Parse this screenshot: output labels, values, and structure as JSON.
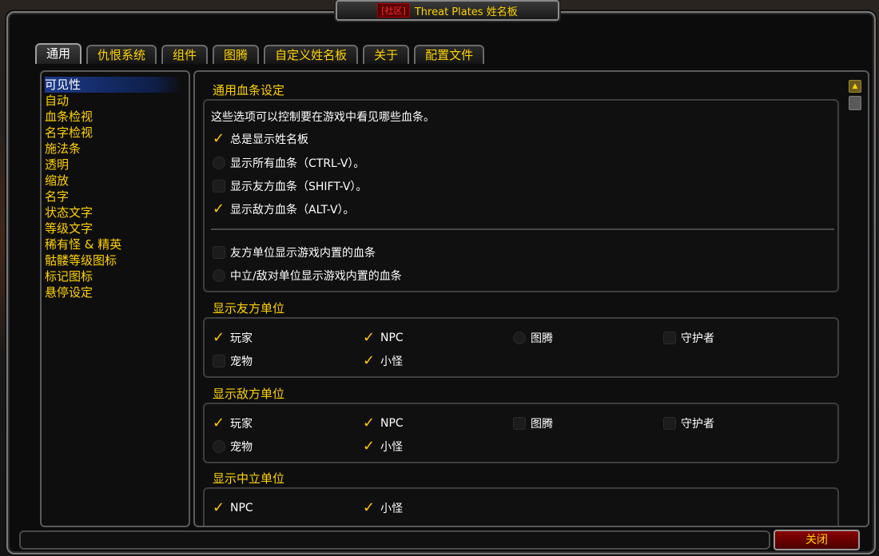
{
  "window": {
    "title_tag": "[社区]",
    "title": "Threat Plates 姓名板"
  },
  "tabs": [
    {
      "label": "通用"
    },
    {
      "label": "仇恨系统"
    },
    {
      "label": "组件"
    },
    {
      "label": "图腾"
    },
    {
      "label": "自定义姓名板"
    },
    {
      "label": "关于"
    },
    {
      "label": "配置文件"
    }
  ],
  "sidebar": {
    "items": [
      {
        "label": "可见性"
      },
      {
        "label": "自动"
      },
      {
        "label": "血条检视"
      },
      {
        "label": "名字检视"
      },
      {
        "label": "施法条"
      },
      {
        "label": "透明"
      },
      {
        "label": "缩放"
      },
      {
        "label": "名字"
      },
      {
        "label": "状态文字"
      },
      {
        "label": "等级文字"
      },
      {
        "label": "稀有怪 & 精英"
      },
      {
        "label": "骷髅等级图标"
      },
      {
        "label": "标记图标"
      },
      {
        "label": "悬停设定"
      }
    ]
  },
  "sections": {
    "general": {
      "title": "通用血条设定",
      "description": "这些选项可以控制要在游戏中看见哪些血条。",
      "options": [
        {
          "label": "总是显示姓名板",
          "checked": true
        },
        {
          "label": "显示所有血条（CTRL-V）。",
          "checked": false
        },
        {
          "label": "显示友方血条（SHIFT-V）。",
          "checked": false
        },
        {
          "label": "显示敌方血条（ALT-V）。",
          "checked": true
        },
        {
          "label": "友方单位显示游戏内置的血条",
          "checked": false
        },
        {
          "label": "中立/敌对单位显示游戏内置的血条",
          "checked": false
        }
      ]
    },
    "friendly": {
      "title": "显示友方单位",
      "options": [
        {
          "label": "玩家",
          "checked": true
        },
        {
          "label": "NPC",
          "checked": true
        },
        {
          "label": "图腾",
          "checked": false
        },
        {
          "label": "守护者",
          "checked": false
        },
        {
          "label": "宠物",
          "checked": false
        },
        {
          "label": "小怪",
          "checked": true
        }
      ]
    },
    "enemy": {
      "title": "显示敌方单位",
      "options": [
        {
          "label": "玩家",
          "checked": true
        },
        {
          "label": "NPC",
          "checked": true
        },
        {
          "label": "图腾",
          "checked": false
        },
        {
          "label": "守护者",
          "checked": false
        },
        {
          "label": "宠物",
          "checked": false
        },
        {
          "label": "小怪",
          "checked": true
        }
      ]
    },
    "neutral": {
      "title": "显示中立单位",
      "options": [
        {
          "label": "NPC",
          "checked": true
        },
        {
          "label": "小怪",
          "checked": true
        }
      ]
    }
  },
  "footer": {
    "close_label": "关闭"
  },
  "colors": {
    "gold": "#ffd200",
    "check": "#ffc800",
    "selection": "#1c3a8a",
    "close_button": "#8a0000"
  },
  "icons": {
    "checked": "checkmark-icon",
    "unchecked": "empty-checkbox-icon",
    "scroll_up": "scroll-up-arrow-icon"
  }
}
